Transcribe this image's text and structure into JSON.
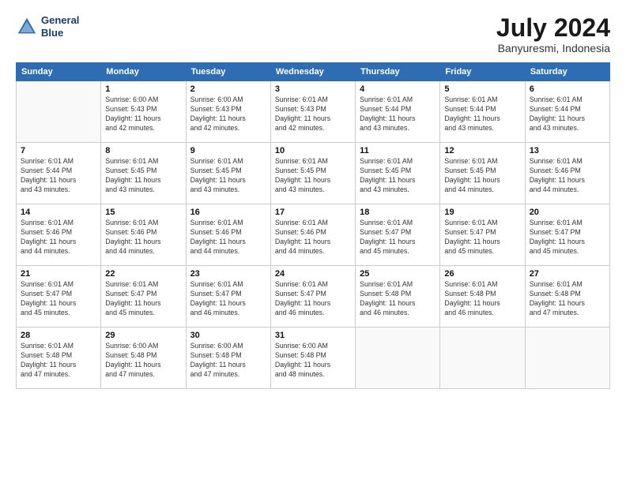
{
  "logo": {
    "line1": "General",
    "line2": "Blue"
  },
  "title": "July 2024",
  "subtitle": "Banyuresmi, Indonesia",
  "days_header": [
    "Sunday",
    "Monday",
    "Tuesday",
    "Wednesday",
    "Thursday",
    "Friday",
    "Saturday"
  ],
  "weeks": [
    [
      {
        "num": "",
        "sunrise": "",
        "sunset": "",
        "daylight": "",
        "empty": true
      },
      {
        "num": "1",
        "sunrise": "Sunrise: 6:00 AM",
        "sunset": "Sunset: 5:43 PM",
        "daylight": "Daylight: 11 hours and 42 minutes."
      },
      {
        "num": "2",
        "sunrise": "Sunrise: 6:00 AM",
        "sunset": "Sunset: 5:43 PM",
        "daylight": "Daylight: 11 hours and 42 minutes."
      },
      {
        "num": "3",
        "sunrise": "Sunrise: 6:01 AM",
        "sunset": "Sunset: 5:43 PM",
        "daylight": "Daylight: 11 hours and 42 minutes."
      },
      {
        "num": "4",
        "sunrise": "Sunrise: 6:01 AM",
        "sunset": "Sunset: 5:44 PM",
        "daylight": "Daylight: 11 hours and 43 minutes."
      },
      {
        "num": "5",
        "sunrise": "Sunrise: 6:01 AM",
        "sunset": "Sunset: 5:44 PM",
        "daylight": "Daylight: 11 hours and 43 minutes."
      },
      {
        "num": "6",
        "sunrise": "Sunrise: 6:01 AM",
        "sunset": "Sunset: 5:44 PM",
        "daylight": "Daylight: 11 hours and 43 minutes."
      }
    ],
    [
      {
        "num": "7",
        "sunrise": "Sunrise: 6:01 AM",
        "sunset": "Sunset: 5:44 PM",
        "daylight": "Daylight: 11 hours and 43 minutes."
      },
      {
        "num": "8",
        "sunrise": "Sunrise: 6:01 AM",
        "sunset": "Sunset: 5:45 PM",
        "daylight": "Daylight: 11 hours and 43 minutes."
      },
      {
        "num": "9",
        "sunrise": "Sunrise: 6:01 AM",
        "sunset": "Sunset: 5:45 PM",
        "daylight": "Daylight: 11 hours and 43 minutes."
      },
      {
        "num": "10",
        "sunrise": "Sunrise: 6:01 AM",
        "sunset": "Sunset: 5:45 PM",
        "daylight": "Daylight: 11 hours and 43 minutes."
      },
      {
        "num": "11",
        "sunrise": "Sunrise: 6:01 AM",
        "sunset": "Sunset: 5:45 PM",
        "daylight": "Daylight: 11 hours and 43 minutes."
      },
      {
        "num": "12",
        "sunrise": "Sunrise: 6:01 AM",
        "sunset": "Sunset: 5:45 PM",
        "daylight": "Daylight: 11 hours and 44 minutes."
      },
      {
        "num": "13",
        "sunrise": "Sunrise: 6:01 AM",
        "sunset": "Sunset: 5:46 PM",
        "daylight": "Daylight: 11 hours and 44 minutes."
      }
    ],
    [
      {
        "num": "14",
        "sunrise": "Sunrise: 6:01 AM",
        "sunset": "Sunset: 5:46 PM",
        "daylight": "Daylight: 11 hours and 44 minutes."
      },
      {
        "num": "15",
        "sunrise": "Sunrise: 6:01 AM",
        "sunset": "Sunset: 5:46 PM",
        "daylight": "Daylight: 11 hours and 44 minutes."
      },
      {
        "num": "16",
        "sunrise": "Sunrise: 6:01 AM",
        "sunset": "Sunset: 5:46 PM",
        "daylight": "Daylight: 11 hours and 44 minutes."
      },
      {
        "num": "17",
        "sunrise": "Sunrise: 6:01 AM",
        "sunset": "Sunset: 5:46 PM",
        "daylight": "Daylight: 11 hours and 44 minutes."
      },
      {
        "num": "18",
        "sunrise": "Sunrise: 6:01 AM",
        "sunset": "Sunset: 5:47 PM",
        "daylight": "Daylight: 11 hours and 45 minutes."
      },
      {
        "num": "19",
        "sunrise": "Sunrise: 6:01 AM",
        "sunset": "Sunset: 5:47 PM",
        "daylight": "Daylight: 11 hours and 45 minutes."
      },
      {
        "num": "20",
        "sunrise": "Sunrise: 6:01 AM",
        "sunset": "Sunset: 5:47 PM",
        "daylight": "Daylight: 11 hours and 45 minutes."
      }
    ],
    [
      {
        "num": "21",
        "sunrise": "Sunrise: 6:01 AM",
        "sunset": "Sunset: 5:47 PM",
        "daylight": "Daylight: 11 hours and 45 minutes."
      },
      {
        "num": "22",
        "sunrise": "Sunrise: 6:01 AM",
        "sunset": "Sunset: 5:47 PM",
        "daylight": "Daylight: 11 hours and 45 minutes."
      },
      {
        "num": "23",
        "sunrise": "Sunrise: 6:01 AM",
        "sunset": "Sunset: 5:47 PM",
        "daylight": "Daylight: 11 hours and 46 minutes."
      },
      {
        "num": "24",
        "sunrise": "Sunrise: 6:01 AM",
        "sunset": "Sunset: 5:47 PM",
        "daylight": "Daylight: 11 hours and 46 minutes."
      },
      {
        "num": "25",
        "sunrise": "Sunrise: 6:01 AM",
        "sunset": "Sunset: 5:48 PM",
        "daylight": "Daylight: 11 hours and 46 minutes."
      },
      {
        "num": "26",
        "sunrise": "Sunrise: 6:01 AM",
        "sunset": "Sunset: 5:48 PM",
        "daylight": "Daylight: 11 hours and 46 minutes."
      },
      {
        "num": "27",
        "sunrise": "Sunrise: 6:01 AM",
        "sunset": "Sunset: 5:48 PM",
        "daylight": "Daylight: 11 hours and 47 minutes."
      }
    ],
    [
      {
        "num": "28",
        "sunrise": "Sunrise: 6:01 AM",
        "sunset": "Sunset: 5:48 PM",
        "daylight": "Daylight: 11 hours and 47 minutes."
      },
      {
        "num": "29",
        "sunrise": "Sunrise: 6:00 AM",
        "sunset": "Sunset: 5:48 PM",
        "daylight": "Daylight: 11 hours and 47 minutes."
      },
      {
        "num": "30",
        "sunrise": "Sunrise: 6:00 AM",
        "sunset": "Sunset: 5:48 PM",
        "daylight": "Daylight: 11 hours and 47 minutes."
      },
      {
        "num": "31",
        "sunrise": "Sunrise: 6:00 AM",
        "sunset": "Sunset: 5:48 PM",
        "daylight": "Daylight: 11 hours and 48 minutes."
      },
      {
        "num": "",
        "sunrise": "",
        "sunset": "",
        "daylight": "",
        "empty": true
      },
      {
        "num": "",
        "sunrise": "",
        "sunset": "",
        "daylight": "",
        "empty": true
      },
      {
        "num": "",
        "sunrise": "",
        "sunset": "",
        "daylight": "",
        "empty": true
      }
    ]
  ]
}
